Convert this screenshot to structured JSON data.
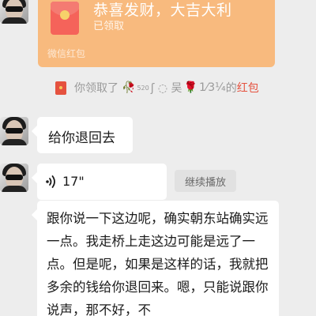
{
  "red_packet": {
    "title": "恭喜发财，大吉大利",
    "status": "已领取",
    "footer": "微信红包"
  },
  "system_notice": {
    "prefix": "你领取了",
    "name_part1": "🥀",
    "name_sup": "520",
    "name_part2": "ʃ ◌ 吴",
    "rose": "🌹",
    "name_part3": "1⁄3¼",
    "connector": "的",
    "link": "红包"
  },
  "messages": [
    {
      "type": "text",
      "text": "给你退回去"
    },
    {
      "type": "voice",
      "duration": "17\"",
      "action": "继续播放"
    },
    {
      "type": "text",
      "text": "跟你说一下这边呢，确实朝东站确实远一点。我走桥上走这边可能是远了一点。但是呢，如果是这样的话，我就把多余的钱给你退回来。嗯，只能说跟你说声，那不好，不"
    }
  ],
  "colors": {
    "background": "#ededed",
    "red_packet_card": "#f8ba7e",
    "red_packet_icon": "#f5635a",
    "bubble": "#ffffff",
    "link_red": "#e5523f"
  }
}
